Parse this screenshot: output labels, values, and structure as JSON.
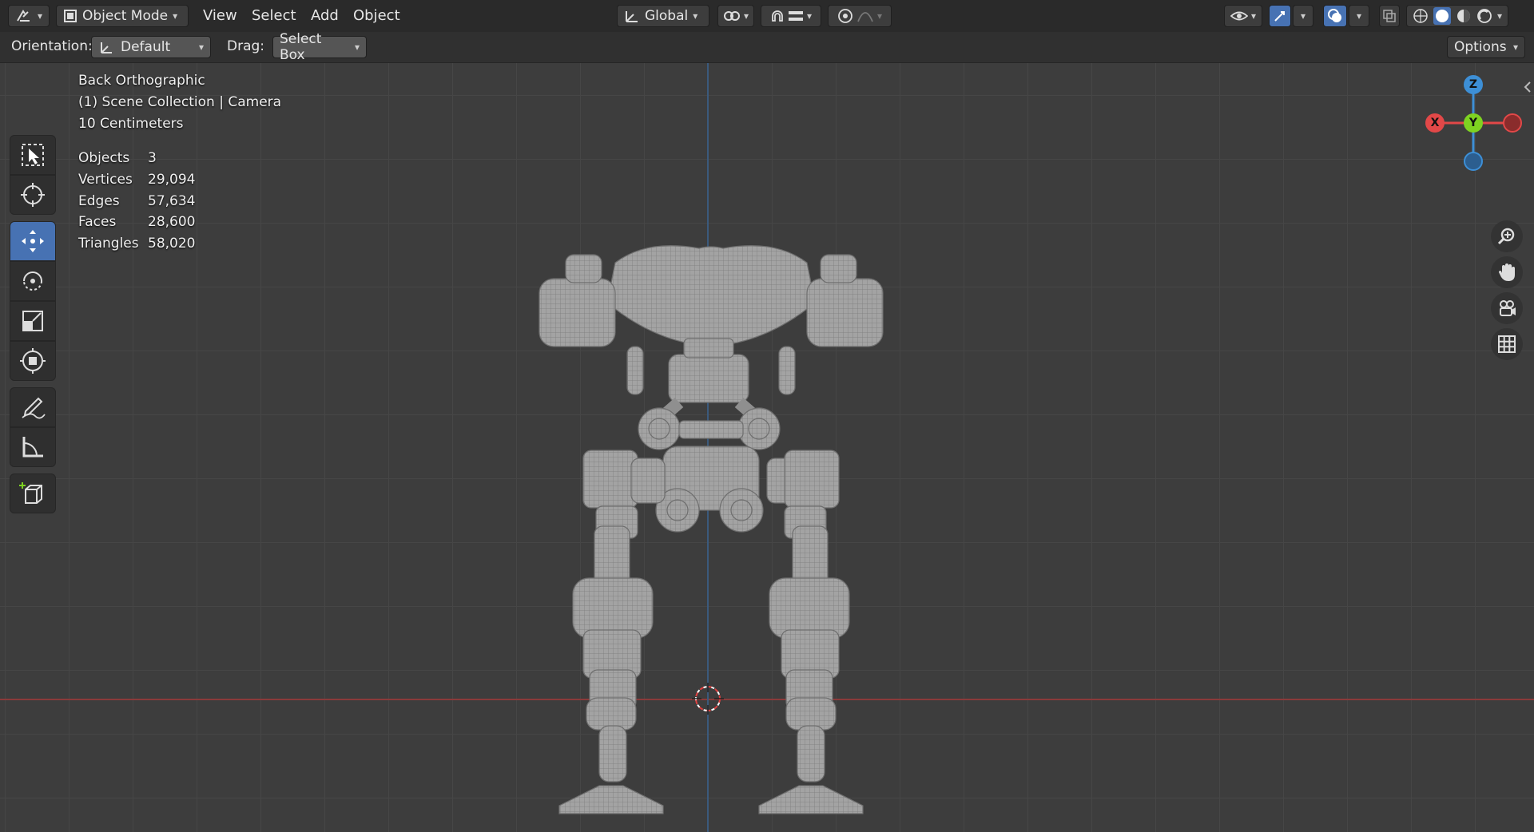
{
  "header": {
    "editor_type_icon": "editor-type-icon",
    "mode": "Object Mode",
    "menus": [
      "View",
      "Select",
      "Add",
      "Object"
    ],
    "transform_orientation": "Global",
    "options_label": "Options"
  },
  "toolbar": {
    "orientation_label": "Orientation:",
    "orientation_value": "Default",
    "drag_label": "Drag:",
    "drag_value": "Select Box"
  },
  "viewport": {
    "view_name": "Back Orthographic",
    "collection": "(1) Scene Collection | Camera",
    "scale": "10 Centimeters",
    "stats": [
      {
        "key": "Objects",
        "value": "3"
      },
      {
        "key": "Vertices",
        "value": "29,094"
      },
      {
        "key": "Edges",
        "value": "57,634"
      },
      {
        "key": "Faces",
        "value": "28,600"
      },
      {
        "key": "Triangles",
        "value": "58,020"
      }
    ],
    "gizmo": {
      "x": "X",
      "y": "Y",
      "z": "Z"
    }
  },
  "tools": [
    "select-box-icon",
    "cursor-icon",
    "move-icon",
    "rotate-icon",
    "scale-icon",
    "transform-icon",
    "annotate-icon",
    "measure-icon",
    "add-cube-icon"
  ],
  "colors": {
    "accent": "#4772b3",
    "x_axis": "#e24848",
    "y_axis": "#7ed321",
    "z_axis": "#3d8fd6"
  }
}
